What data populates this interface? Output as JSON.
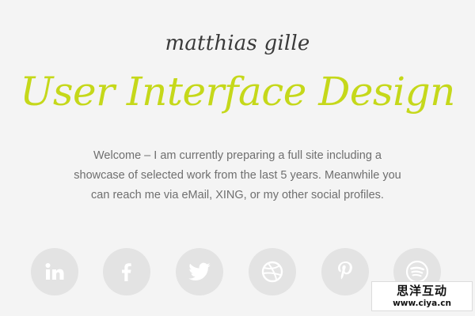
{
  "header": {
    "author": "matthias gille",
    "title": "User Interface Design"
  },
  "intro": {
    "lines": [
      "Welcome – I am currently preparing a full site including a",
      "showcase of selected work from the last 5 years. Meanwhile you",
      "can reach me via eMail, XING, or my other social profiles."
    ]
  },
  "social": [
    {
      "icon": "linkedin-icon"
    },
    {
      "icon": "facebook-icon"
    },
    {
      "icon": "twitter-icon"
    },
    {
      "icon": "dribbble-icon"
    },
    {
      "icon": "pinterest-icon"
    },
    {
      "icon": "spotify-icon"
    }
  ],
  "watermark": {
    "name": "思洋互动",
    "url": "www.ciya.cn"
  },
  "colors": {
    "background": "#f4f4f4",
    "accent": "#c5d81a",
    "author": "#3a3a3a",
    "body_text": "#6f6f6f",
    "icon_circle": "#e3e3e3",
    "icon_glyph": "#ffffff"
  }
}
